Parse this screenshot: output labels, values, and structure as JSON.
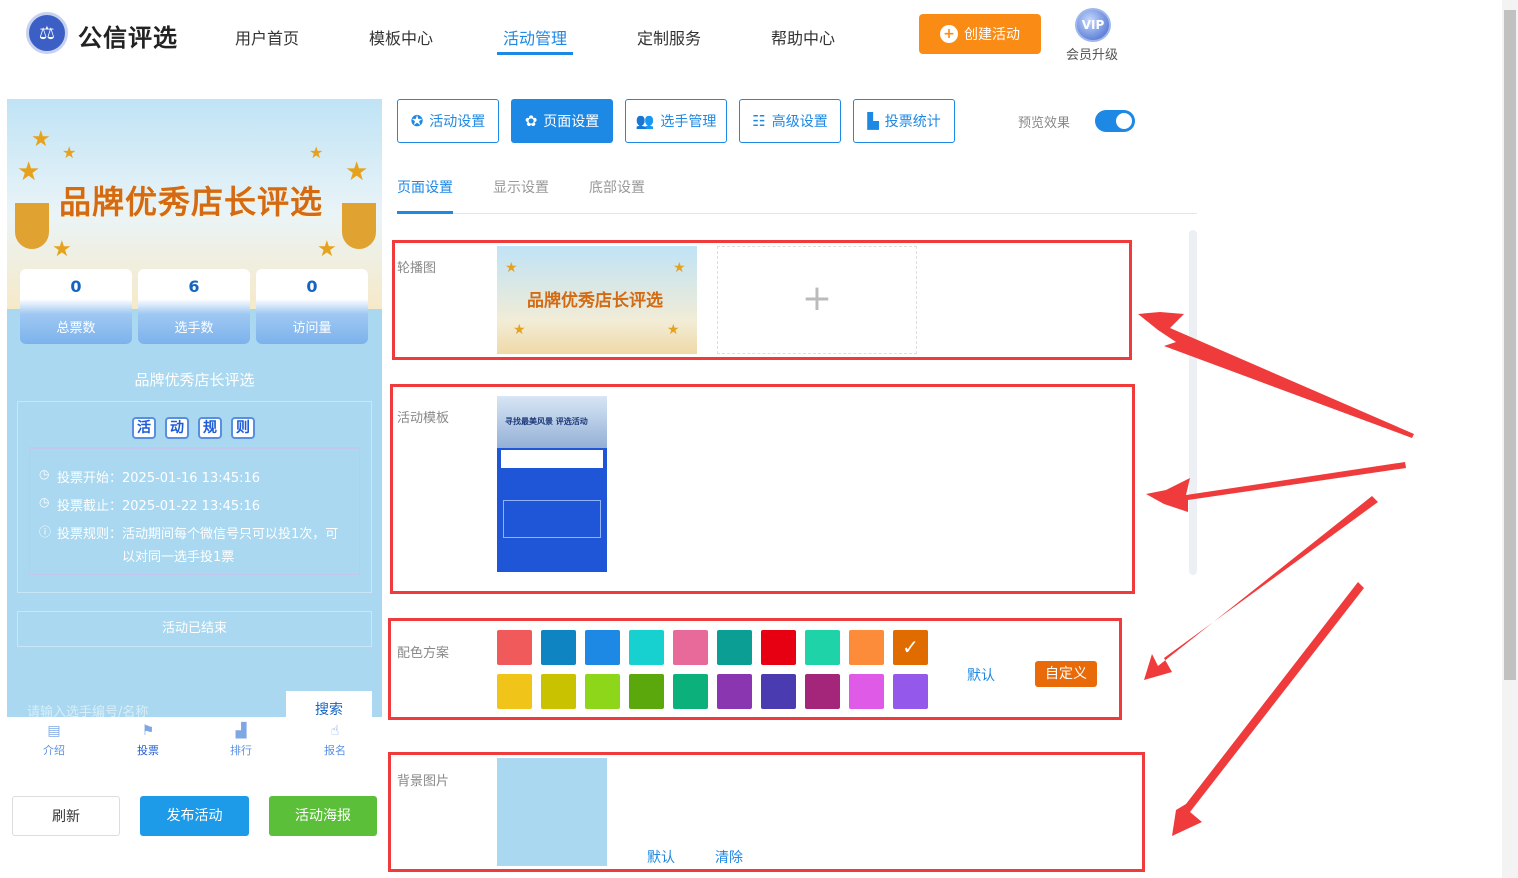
{
  "header": {
    "brand": "公信评选",
    "nav": [
      "用户首页",
      "模板中心",
      "活动管理",
      "定制服务",
      "帮助中心"
    ],
    "active_nav": "活动管理",
    "create_label": "创建活动",
    "vip_badge": "VIP",
    "vip_label": "会员升级"
  },
  "preview": {
    "banner_title": "品牌优秀店长评选",
    "stats": [
      {
        "value": "0",
        "label": "总票数"
      },
      {
        "value": "6",
        "label": "选手数"
      },
      {
        "value": "0",
        "label": "访问量"
      }
    ],
    "title": "品牌优秀店长评选",
    "rules_chars": [
      "活",
      "动",
      "规",
      "则"
    ],
    "rules": [
      "投票开始：2025-01-16 13:45:16",
      "投票截止：2025-01-22 13:45:16",
      "投票规则：活动期间每个微信号只可以投1次，可",
      "以对同一选手投1票"
    ],
    "ended": "活动已结束",
    "search_placeholder": "请输入选手编号/名称",
    "search_button": "搜索",
    "tabs": [
      {
        "label": "介绍",
        "icon": "document-icon"
      },
      {
        "label": "投票",
        "icon": "flag-icon"
      },
      {
        "label": "排行",
        "icon": "bar-chart-icon"
      },
      {
        "label": "报名",
        "icon": "hand-pointer-icon"
      }
    ]
  },
  "actions": {
    "refresh": "刷新",
    "publish": "发布活动",
    "poster": "活动海报"
  },
  "toolbar": [
    {
      "label": "活动设置",
      "icon": "star-icon"
    },
    {
      "label": "页面设置",
      "icon": "gear-icon"
    },
    {
      "label": "选手管理",
      "icon": "users-icon"
    },
    {
      "label": "高级设置",
      "icon": "sliders-icon"
    },
    {
      "label": "投票统计",
      "icon": "bar-chart-icon"
    }
  ],
  "active_toolbar": "页面设置",
  "preview_toggle": {
    "label": "预览效果",
    "on": true
  },
  "subtabs": [
    "页面设置",
    "显示设置",
    "底部设置"
  ],
  "sections": {
    "carousel": {
      "label": "轮播图",
      "image_title": "品牌优秀店长评选"
    },
    "template": {
      "label": "活动模板",
      "image_title": "寻找最美风景 评选活动"
    },
    "colors": {
      "label": "配色方案",
      "row1": [
        "#f05a5a",
        "#0e84c2",
        "#1e88e5",
        "#17d1d1",
        "#e86a9a",
        "#0a9e94",
        "#e60012",
        "#1dd3a7",
        "#fd8c3a",
        "#e06c00"
      ],
      "row2": [
        "#f0c419",
        "#c8c200",
        "#8ed61a",
        "#5aa80b",
        "#0bb07b",
        "#8a36b0",
        "#4a3bb0",
        "#a4267a",
        "#e05ae8",
        "#9458ea"
      ],
      "selected": "#e06c00",
      "default_label": "默认",
      "custom_label": "自定义"
    },
    "background": {
      "label": "背景图片",
      "bg_color": "#a9d8f0",
      "default_label": "默认",
      "clear_label": "清除"
    }
  }
}
